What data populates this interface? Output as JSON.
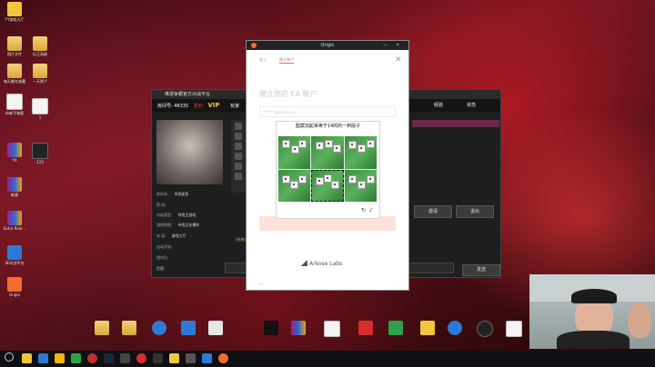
{
  "desktop_left_icons": [
    {
      "label": "YY游戏大厅",
      "icon": "cat-icon"
    },
    {
      "label": "相片文件",
      "icon": "folder-icon"
    },
    {
      "label": "反正高级",
      "icon": "folder-icon"
    },
    {
      "label": "每天都在收藏",
      "icon": "folder-icon"
    },
    {
      "label": "一天两个",
      "icon": "folder-icon"
    },
    {
      "label": "kk新手装配",
      "icon": "doc-icon"
    },
    {
      "label": "1",
      "icon": "doc-icon"
    },
    {
      "label": "YX",
      "icon": "rar-icon"
    },
    {
      "label": "123",
      "icon": "dark-icon"
    },
    {
      "label": "新建",
      "icon": "rar-icon"
    },
    {
      "label": "Extra Role...",
      "icon": "rar-icon"
    },
    {
      "label": "SE对战平台",
      "icon": "blue-icon"
    },
    {
      "label": "Origin",
      "icon": "origin-icon"
    }
  ],
  "launcher": {
    "title": "维游争霸官方对战平台",
    "room_label": "房间号:",
    "room_number": "46335",
    "room_tag": "签到",
    "vip": "VIP",
    "tab_friends": "玩家",
    "col_score": "经验",
    "col_state": "状态",
    "fields": [
      {
        "label": "房间名:",
        "value": "寻找紧急"
      },
      {
        "label": "密    码:",
        "value": ""
      },
      {
        "label": "对局类型:",
        "value": "寻找主游戏"
      },
      {
        "label": "游戏地图:",
        "value": "寻找正在爆炸"
      },
      {
        "label": "本    局:",
        "value": "游戏大厅"
      },
      {
        "label": "自动开始:",
        "value": ""
      },
      {
        "label": "相对位:",
        "value": ""
      },
      {
        "label": "提醒:",
        "value": ""
      }
    ],
    "btn_invite": "邀请",
    "btn_exit": "退出",
    "btn_send": "发送",
    "system_msg": "[系统]"
  },
  "origin": {
    "window_title": "Origin",
    "tab1": "登入",
    "tab2": "建立账户",
    "heading": "建立您的 EA 帐户",
    "email": "******@gmail.com",
    "brand": "Arkose Labs",
    "footer": "EA"
  },
  "captcha": {
    "prompt": "图案加起来等于14的的一到骰子",
    "selected_cell": 4
  }
}
